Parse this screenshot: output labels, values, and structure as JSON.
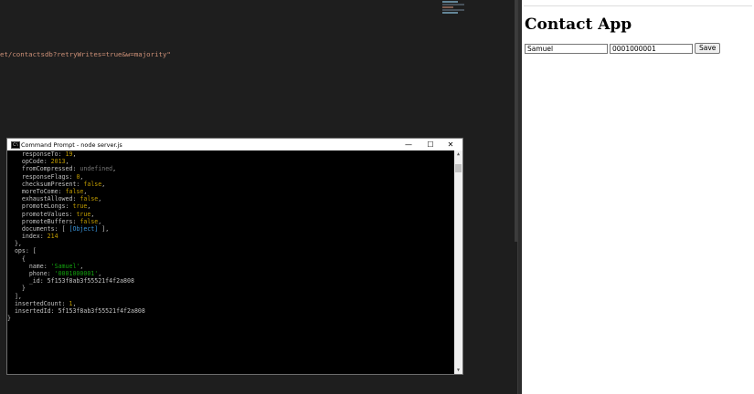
{
  "editor": {
    "code_line": "et/contactsdb?retryWrites=true&w=majority\""
  },
  "browser": {
    "address": "",
    "app_title": "Contact App",
    "name_value": "Samuel",
    "phone_value": "0001000001",
    "save_label": "Save"
  },
  "terminal": {
    "title": "Command Prompt - node  server.js",
    "lines": [
      [
        [
          "    responseTo: ",
          "k"
        ],
        [
          "19",
          "num"
        ],
        [
          ",",
          "k"
        ]
      ],
      [
        [
          "    opCode: ",
          "k"
        ],
        [
          "2013",
          "num"
        ],
        [
          ",",
          "k"
        ]
      ],
      [
        [
          "    fromCompressed: ",
          "k"
        ],
        [
          "undefined",
          "undef"
        ],
        [
          ",",
          "k"
        ]
      ],
      [
        [
          "    responseFlags: ",
          "k"
        ],
        [
          "0",
          "num"
        ],
        [
          ",",
          "k"
        ]
      ],
      [
        [
          "    checksumPresent: ",
          "k"
        ],
        [
          "false",
          "bool"
        ],
        [
          ",",
          "k"
        ]
      ],
      [
        [
          "    moreToCome: ",
          "k"
        ],
        [
          "false",
          "bool"
        ],
        [
          ",",
          "k"
        ]
      ],
      [
        [
          "    exhaustAllowed: ",
          "k"
        ],
        [
          "false",
          "bool"
        ],
        [
          ",",
          "k"
        ]
      ],
      [
        [
          "    promoteLongs: ",
          "k"
        ],
        [
          "true",
          "bool"
        ],
        [
          ",",
          "k"
        ]
      ],
      [
        [
          "    promoteValues: ",
          "k"
        ],
        [
          "true",
          "bool"
        ],
        [
          ",",
          "k"
        ]
      ],
      [
        [
          "    promoteBuffers: ",
          "k"
        ],
        [
          "false",
          "bool"
        ],
        [
          ",",
          "k"
        ]
      ],
      [
        [
          "    documents: [ ",
          "k"
        ],
        [
          "[Object]",
          "obj"
        ],
        [
          " ],",
          "k"
        ]
      ],
      [
        [
          "    index: ",
          "k"
        ],
        [
          "214",
          "num"
        ]
      ],
      [
        [
          "  },",
          "k"
        ]
      ],
      [
        [
          "  ops: [",
          "k"
        ]
      ],
      [
        [
          "    {",
          "k"
        ]
      ],
      [
        [
          "      name: ",
          "k"
        ],
        [
          "'Samuel'",
          "str"
        ],
        [
          ",",
          "k"
        ]
      ],
      [
        [
          "      phone: ",
          "k"
        ],
        [
          "'0001000001'",
          "str"
        ],
        [
          ",",
          "k"
        ]
      ],
      [
        [
          "      _id: 5f153f8ab3f55521f4f2a808",
          "k"
        ]
      ],
      [
        [
          "    }",
          "k"
        ]
      ],
      [
        [
          "  ],",
          "k"
        ]
      ],
      [
        [
          "  insertedCount: ",
          "k"
        ],
        [
          "1",
          "num"
        ],
        [
          ",",
          "k"
        ]
      ],
      [
        [
          "  insertedId: 5f153f8ab3f55521f4f2a808",
          "k"
        ]
      ],
      [
        [
          "}",
          "k"
        ]
      ]
    ]
  }
}
